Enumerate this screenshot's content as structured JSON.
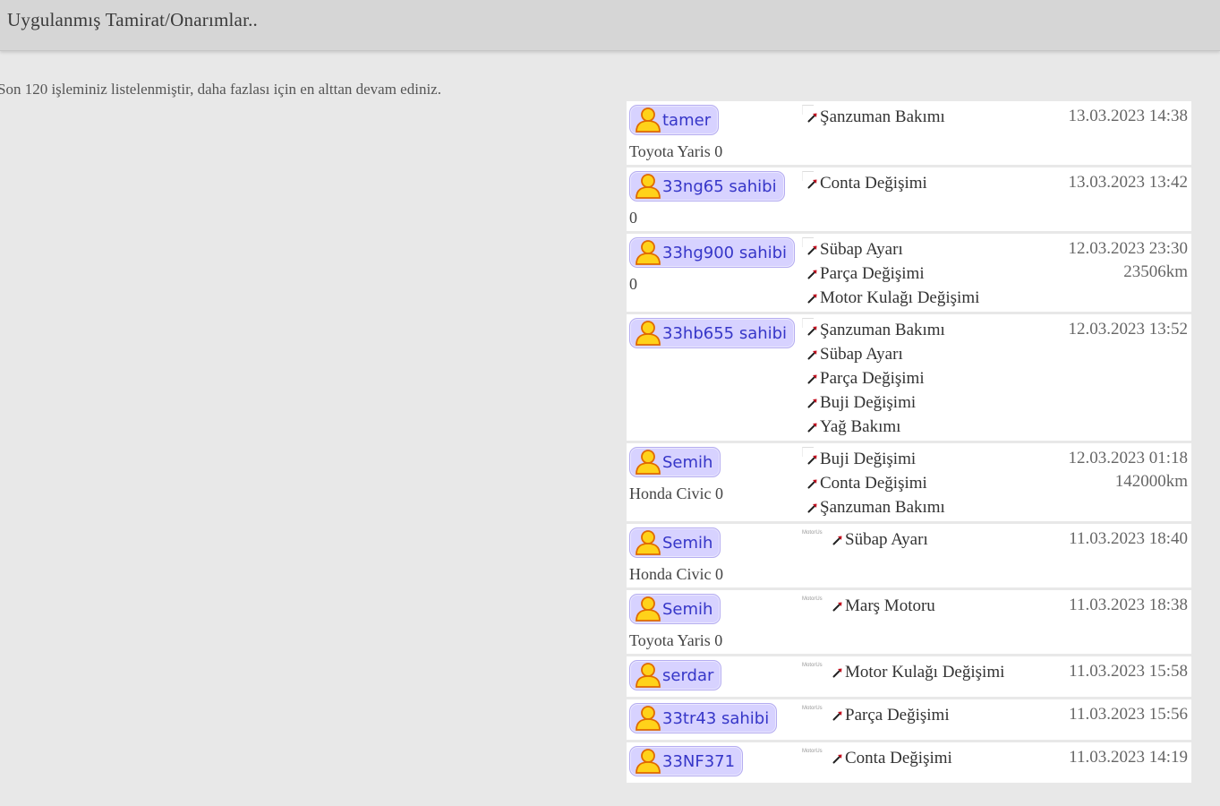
{
  "header": {
    "title": "Uygulanmış Tamirat/Onarımlar.."
  },
  "notice": "Son 120 işleminiz listelenmiştir, daha fazlası için en alttan devam ediniz.",
  "colors": {
    "badge_bg": "#d7d2ff",
    "badge_text": "#3636c8",
    "icon_fill": "#ffd21a",
    "arrow": "#c41020"
  },
  "icons": {
    "user": "user-icon",
    "service": "wrench-icon"
  },
  "thumb_label": "MotorUs",
  "records": [
    {
      "user": "tamer",
      "car": "Toyota Yaris 0",
      "thumb": false,
      "services": [
        "Şanzuman Bakımı"
      ],
      "date": "13.03.2023 14:38",
      "km": ""
    },
    {
      "user": "33ng65 sahibi",
      "car": "0",
      "thumb": false,
      "services": [
        "Conta Değişimi"
      ],
      "date": "13.03.2023 13:42",
      "km": ""
    },
    {
      "user": "33hg900 sahibi",
      "car": "0",
      "thumb": false,
      "services": [
        "Sübap Ayarı",
        "Parça Değişimi",
        "Motor Kulağı Değişimi"
      ],
      "date": "12.03.2023 23:30",
      "km": "23506km"
    },
    {
      "user": "33hb655 sahibi",
      "car": "",
      "thumb": false,
      "services": [
        "Şanzuman Bakımı",
        "Sübap Ayarı",
        "Parça Değişimi",
        "Buji Değişimi",
        "Yağ Bakımı"
      ],
      "date": "12.03.2023 13:52",
      "km": ""
    },
    {
      "user": "Semih",
      "car": "Honda Civic 0",
      "thumb": false,
      "services": [
        "Buji Değişimi",
        "Conta Değişimi",
        "Şanzuman Bakımı"
      ],
      "date": "12.03.2023 01:18",
      "km": "142000km"
    },
    {
      "user": "Semih",
      "car": "Honda Civic 0",
      "thumb": true,
      "services": [
        "Sübap Ayarı"
      ],
      "date": "11.03.2023 18:40",
      "km": ""
    },
    {
      "user": "Semih",
      "car": "Toyota Yaris 0",
      "thumb": true,
      "services": [
        "Marş Motoru"
      ],
      "date": "11.03.2023 18:38",
      "km": ""
    },
    {
      "user": "serdar",
      "car": "",
      "thumb": true,
      "services": [
        "Motor Kulağı Değişimi"
      ],
      "date": "11.03.2023 15:58",
      "km": ""
    },
    {
      "user": "33tr43 sahibi",
      "car": "",
      "thumb": true,
      "services": [
        "Parça Değişimi"
      ],
      "date": "11.03.2023 15:56",
      "km": ""
    },
    {
      "user": "33NF371",
      "car": "",
      "thumb": true,
      "services": [
        "Conta Değişimi"
      ],
      "date": "11.03.2023 14:19",
      "km": ""
    }
  ]
}
